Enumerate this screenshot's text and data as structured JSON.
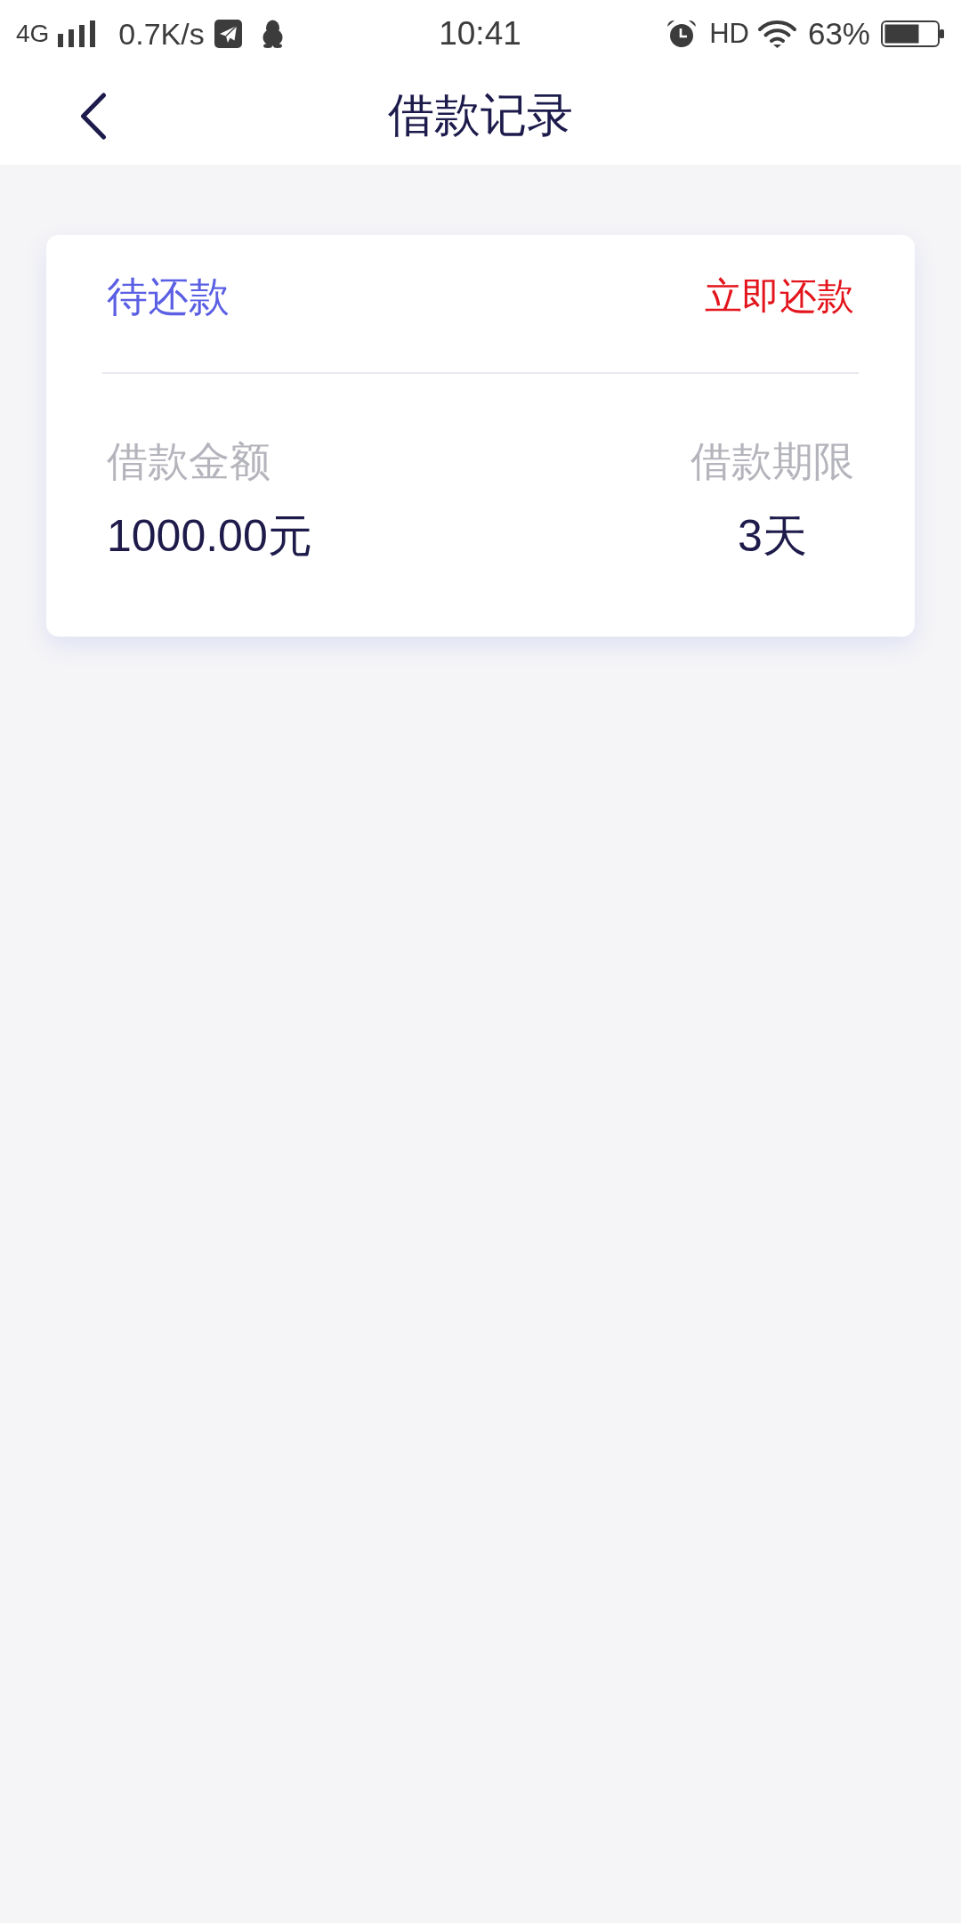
{
  "status_bar": {
    "network": "4G",
    "speed": "0.7K/s",
    "time": "10:41",
    "hd": "HD",
    "battery": "63%"
  },
  "header": {
    "title": "借款记录"
  },
  "records": [
    {
      "status": "待还款",
      "action": "立即还款",
      "fields": [
        {
          "label": "借款金额",
          "value": "1000.00元"
        },
        {
          "label": "借款期限",
          "value": "3天"
        }
      ]
    }
  ]
}
